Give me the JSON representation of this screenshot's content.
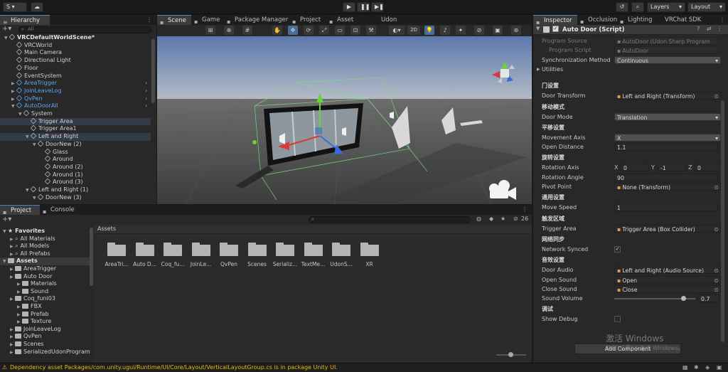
{
  "toolbar": {
    "account_label": "S",
    "layers_label": "Layers",
    "layout_label": "Layout"
  },
  "hierarchy": {
    "tab_label": "Hierarchy",
    "search_placeholder": "All",
    "items": [
      {
        "label": "VRCDefaultWorldScene*",
        "indent": 0,
        "expanded": true,
        "style": "scene"
      },
      {
        "label": "VRCWorld",
        "indent": 1
      },
      {
        "label": "Main Camera",
        "indent": 1
      },
      {
        "label": "Directional Light",
        "indent": 1
      },
      {
        "label": "Floor",
        "indent": 1
      },
      {
        "label": "EventSystem",
        "indent": 1
      },
      {
        "label": "AreaTrigger",
        "indent": 1,
        "blue": true,
        "collapsed": true,
        "arrow": true
      },
      {
        "label": "JoinLeaveLog",
        "indent": 1,
        "blue": true,
        "collapsed": true,
        "arrow": true
      },
      {
        "label": "QvPen",
        "indent": 1,
        "blue": true,
        "collapsed": true,
        "arrow": true
      },
      {
        "label": "AutoDoorAll",
        "indent": 1,
        "blue": true,
        "expanded": true,
        "arrow": true
      },
      {
        "label": "System",
        "indent": 2,
        "expanded": true
      },
      {
        "label": "Trigger Area",
        "indent": 3,
        "selected": true
      },
      {
        "label": "Trigger Area1",
        "indent": 3
      },
      {
        "label": "Left and Right",
        "indent": 3,
        "expanded": true,
        "selected": true
      },
      {
        "label": "DoorNew (2)",
        "indent": 4,
        "expanded": true
      },
      {
        "label": "Glass",
        "indent": 5
      },
      {
        "label": "Around",
        "indent": 5
      },
      {
        "label": "Around (2)",
        "indent": 5
      },
      {
        "label": "Around (1)",
        "indent": 5
      },
      {
        "label": "Around (3)",
        "indent": 5
      },
      {
        "label": "Left and Right (1)",
        "indent": 3,
        "expanded": true
      },
      {
        "label": "DoorNew (3)",
        "indent": 4,
        "expanded": true
      }
    ]
  },
  "scene_tabs": [
    {
      "label": "Scene",
      "icon": "grid-icon",
      "active": true
    },
    {
      "label": "Game",
      "icon": "gamepad-icon"
    },
    {
      "label": "Package Manager",
      "icon": "package-icon"
    },
    {
      "label": "Project",
      "icon": "folder-icon"
    },
    {
      "label": "Asset Store",
      "icon": "store-icon"
    },
    {
      "label": "Udon Graph",
      "icon": ""
    }
  ],
  "scene_toolbar": {
    "mode_2d": "2D"
  },
  "inspector": {
    "tabs": [
      {
        "label": "Inspector",
        "active": true
      },
      {
        "label": "Occlusion"
      },
      {
        "label": "Lighting"
      },
      {
        "label": "VRChat SDK"
      }
    ],
    "component_title": "Auto Door (Script)",
    "rows": [
      {
        "kind": "field",
        "label": "Program Source",
        "value": "AutoDoor (Udon Sharp Program As",
        "dim": true
      },
      {
        "kind": "field",
        "label": "Program Script",
        "value": "AutoDoor",
        "dim": true,
        "indent": true
      },
      {
        "kind": "dropdown",
        "label": "Synchronization Method",
        "value": "Continuous"
      },
      {
        "kind": "fold",
        "label": "Utilities"
      },
      {
        "kind": "gap"
      },
      {
        "kind": "header",
        "label": "门设置"
      },
      {
        "kind": "object",
        "label": "Door Transform",
        "value": "Left and Right (Transform)"
      },
      {
        "kind": "header",
        "label": "移动模式"
      },
      {
        "kind": "dropdown",
        "label": "Door Mode",
        "value": "Translation"
      },
      {
        "kind": "header",
        "label": "平移设置"
      },
      {
        "kind": "dropdown",
        "label": "Movement Axis",
        "value": "X"
      },
      {
        "kind": "field",
        "label": "Open Distance",
        "value": "1.1"
      },
      {
        "kind": "header",
        "label": "旋转设置"
      },
      {
        "kind": "vector",
        "label": "Rotation Axis",
        "x": "0",
        "y": "-1",
        "z": "0"
      },
      {
        "kind": "field",
        "label": "Rotation Angle",
        "value": "90"
      },
      {
        "kind": "object",
        "label": "Pivot Point",
        "value": "None (Transform)"
      },
      {
        "kind": "header",
        "label": "通用设置"
      },
      {
        "kind": "field",
        "label": "Move Speed",
        "value": "1"
      },
      {
        "kind": "header",
        "label": "触发区域"
      },
      {
        "kind": "object",
        "label": "Trigger Area",
        "value": "Trigger Area (Box Collider)"
      },
      {
        "kind": "header",
        "label": "网络同步"
      },
      {
        "kind": "toggle",
        "label": "Network Synced",
        "checked": true
      },
      {
        "kind": "header",
        "label": "音效设置"
      },
      {
        "kind": "object",
        "label": "Door Audio",
        "value": "Left and Right (Audio Source)"
      },
      {
        "kind": "object",
        "label": "Open Sound",
        "value": "Open"
      },
      {
        "kind": "object",
        "label": "Close Sound",
        "value": "Close"
      },
      {
        "kind": "slider",
        "label": "Sound Volume",
        "value": "0.7",
        "fraction": 0.85
      },
      {
        "kind": "header",
        "label": "调试"
      },
      {
        "kind": "toggle",
        "label": "Show Debug",
        "checked": false
      }
    ],
    "add_component": "Add Component",
    "watermark_title": "激活 Windows",
    "watermark_sub": "转到\"设置\"以激活 Windows。"
  },
  "project": {
    "tabs": [
      {
        "label": "Project",
        "active": true
      },
      {
        "label": "Console"
      }
    ],
    "hidden_count": "26",
    "tree": [
      {
        "label": "Favorites",
        "indent": 0,
        "bold": true,
        "star": true
      },
      {
        "label": "All Materials",
        "indent": 1,
        "search": true
      },
      {
        "label": "All Models",
        "indent": 1,
        "search": true
      },
      {
        "label": "All Prefabs",
        "indent": 1,
        "search": true
      },
      {
        "label": "Assets",
        "indent": 0,
        "bold": true,
        "selected": true
      },
      {
        "label": "AreaTrigger",
        "indent": 1
      },
      {
        "label": "Auto Door",
        "indent": 1
      },
      {
        "label": "Materials",
        "indent": 2
      },
      {
        "label": "Sound",
        "indent": 2
      },
      {
        "label": "Coq_funi03",
        "indent": 1
      },
      {
        "label": "FBX",
        "indent": 2
      },
      {
        "label": "Prefab",
        "indent": 2
      },
      {
        "label": "Texture",
        "indent": 2
      },
      {
        "label": "JoinLeaveLog",
        "indent": 1
      },
      {
        "label": "QvPen",
        "indent": 1
      },
      {
        "label": "Scenes",
        "indent": 1
      },
      {
        "label": "SerializedUdonPrograms",
        "indent": 1
      }
    ],
    "breadcrumb": "Assets",
    "folders": [
      "AreaTri...",
      "Auto D...",
      "Coq_fu...",
      "JoinLe...",
      "QvPen",
      "Scenes",
      "Serializ...",
      "TextMe...",
      "UdonS...",
      "XR"
    ]
  },
  "status_bar": {
    "message": "Dependency asset Packages/com.unity.ugui/Runtime/UI/Core/Layout/VerticalLayoutGroup.cs is in package Unity UI."
  },
  "colors": {
    "accent_blue": "#4a88c8",
    "prefab_blue": "#5fa6ee",
    "selection": "#333b48",
    "sky_top": "#5c78ac",
    "ground": "#4a4a4a"
  }
}
